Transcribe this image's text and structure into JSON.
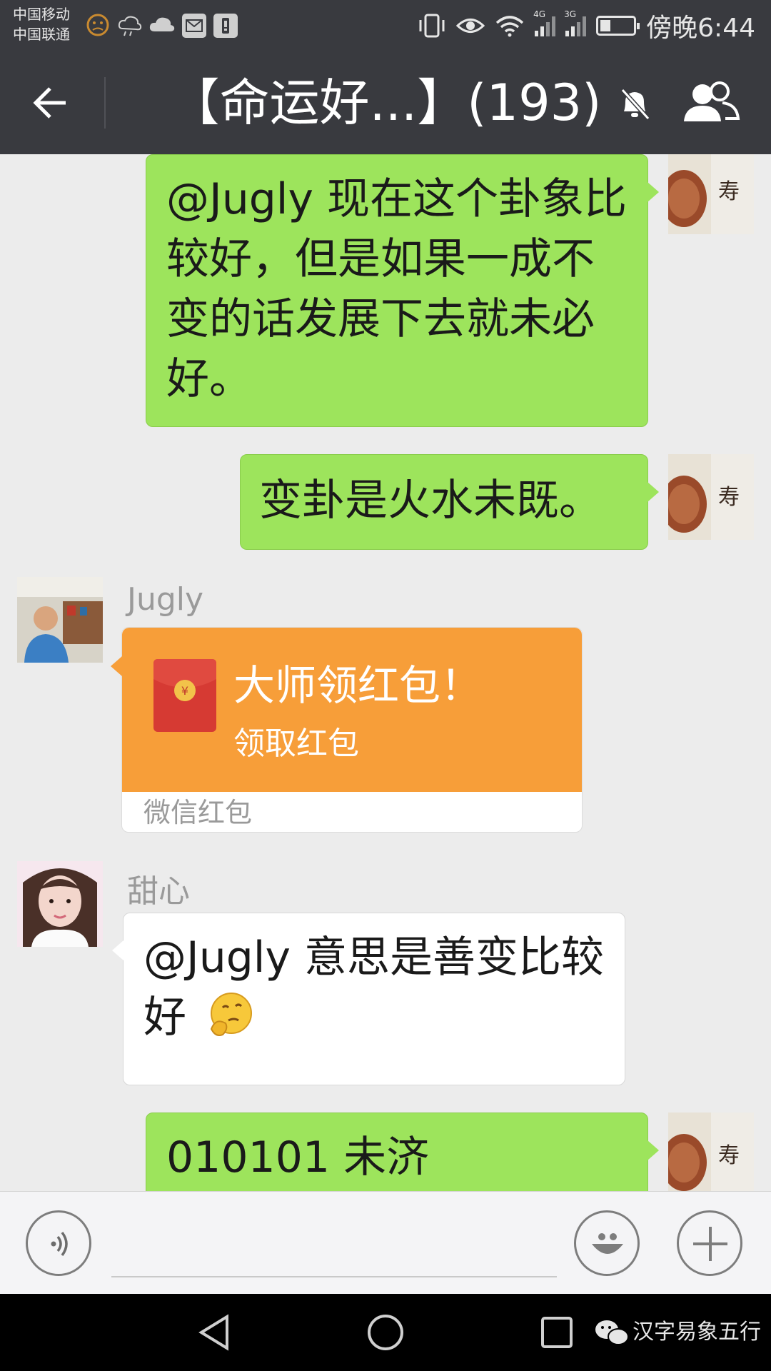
{
  "status_bar": {
    "carrier_1": "中国移动",
    "carrier_2": "中国联通",
    "net_1": "4G",
    "net_2": "3G",
    "time": "傍晚6:44"
  },
  "nav": {
    "title": "【命运好...】(193)"
  },
  "messages": [
    {
      "side": "right",
      "text": "@Jugly 现在这个卦象比较好，但是如果一成不变的话发展下去就未必好。"
    },
    {
      "side": "right",
      "text": "变卦是火水未既。"
    },
    {
      "side": "left",
      "sender": "Jugly",
      "type": "red-packet",
      "title": "大师领红包！",
      "action": "领取红包",
      "footer": "微信红包"
    },
    {
      "side": "left",
      "sender": "甜心",
      "text": "@Jugly 意思是善变比较好"
    },
    {
      "side": "right",
      "text": "010101 未济"
    }
  ],
  "avatar_art": {
    "self_seal_text": "寿 者不赢"
  },
  "bottom": {
    "watermark": "汉字易象五行"
  },
  "colors": {
    "header_bg": "#393a3f",
    "chat_bg": "#ececec",
    "bubble_green": "#9de45c",
    "red_packet": "#f79e39"
  }
}
